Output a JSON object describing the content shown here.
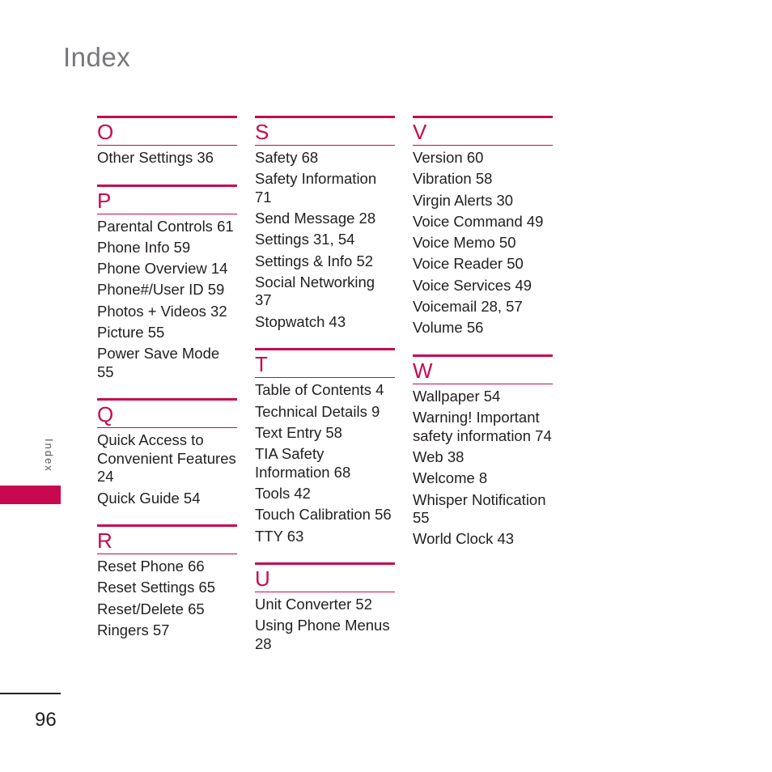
{
  "page": {
    "title": "Index",
    "side_label": "Index",
    "page_number": "96",
    "accent_color": "#c8094f"
  },
  "columns": [
    {
      "sections": [
        {
          "letter": "O",
          "entries": [
            "Other Settings 36"
          ]
        },
        {
          "letter": "P",
          "entries": [
            "Parental Controls 61",
            "Phone Info 59",
            "Phone Overview 14",
            "Phone#/User ID 59",
            "Photos + Videos 32",
            "Picture 55",
            "Power Save Mode 55"
          ]
        },
        {
          "letter": "Q",
          "entries": [
            "Quick Access to Convenient Features 24",
            "Quick Guide 54"
          ]
        },
        {
          "letter": "R",
          "entries": [
            "Reset Phone 66",
            "Reset Settings 65",
            "Reset/Delete 65",
            "Ringers 57"
          ]
        }
      ]
    },
    {
      "sections": [
        {
          "letter": "S",
          "entries": [
            "Safety 68",
            "Safety Information 71",
            "Send Message 28",
            "Settings 31, 54",
            "Settings & Info 52",
            "Social Networking 37",
            "Stopwatch 43"
          ]
        },
        {
          "letter": "T",
          "entries": [
            "Table of Contents 4",
            "Technical Details 9",
            "Text Entry 58",
            "TIA Safety Information 68",
            "Tools 42",
            "Touch Calibration 56",
            "TTY 63"
          ]
        },
        {
          "letter": "U",
          "entries": [
            "Unit Converter 52",
            "Using Phone Menus 28"
          ]
        }
      ]
    },
    {
      "sections": [
        {
          "letter": "V",
          "entries": [
            "Version 60",
            "Vibration 58",
            "Virgin Alerts 30",
            "Voice Command 49",
            "Voice Memo 50",
            "Voice Reader 50",
            "Voice Services 49",
            "Voicemail 28, 57",
            "Volume 56"
          ]
        },
        {
          "letter": "W",
          "entries": [
            "Wallpaper 54",
            "Warning! Important safety information 74",
            "Web 38",
            "Welcome 8",
            "Whisper Notification 55",
            "World Clock 43"
          ]
        }
      ]
    }
  ]
}
